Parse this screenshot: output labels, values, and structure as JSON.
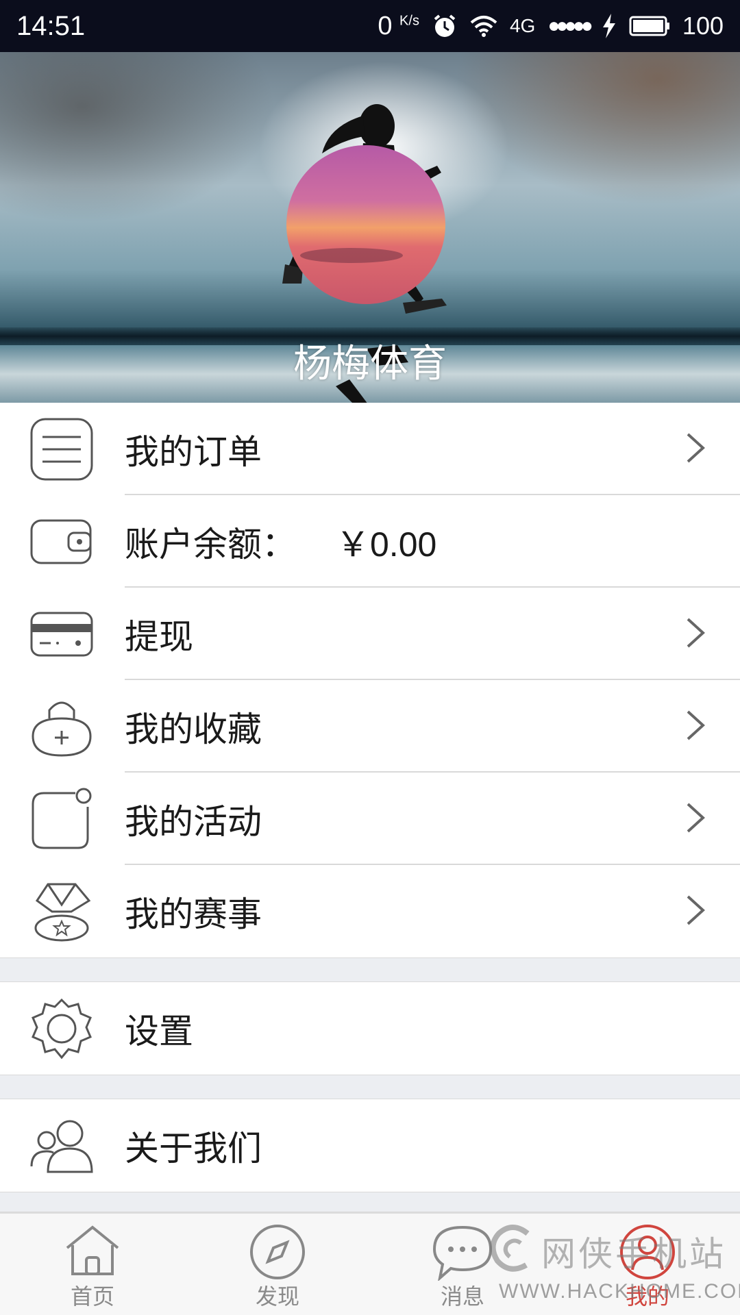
{
  "status_bar": {
    "time": "14:51",
    "net_speed": "0",
    "net_unit": "K/s",
    "network": "4G",
    "signal": "●●●●●",
    "battery": "100"
  },
  "profile": {
    "name": "杨梅体育"
  },
  "menu": {
    "orders": {
      "label": "我的订单"
    },
    "balance": {
      "label": "账户余额：",
      "value": "￥0.00"
    },
    "withdraw": {
      "label": "提现"
    },
    "favorites": {
      "label": "我的收藏"
    },
    "activities": {
      "label": "我的活动"
    },
    "events": {
      "label": "我的赛事"
    },
    "settings": {
      "label": "设置"
    },
    "about": {
      "label": "关于我们"
    }
  },
  "bottom_nav": {
    "items": [
      {
        "label": "首页",
        "icon": "home-icon"
      },
      {
        "label": "发现",
        "icon": "compass-icon"
      },
      {
        "label": "消息",
        "icon": "chat-bubble-icon"
      },
      {
        "label": "我的",
        "icon": "user-icon",
        "active": true
      }
    ]
  },
  "watermark": {
    "text": "网侠手机站",
    "url": "WWW.HACKHOME.COM"
  },
  "colors": {
    "status_bar_bg": "#0b0d1c",
    "active_tab": "#d0453e",
    "inactive_tab": "#8a8a8a",
    "section_gap": "#eceef2",
    "divider": "#d9d9d9"
  }
}
